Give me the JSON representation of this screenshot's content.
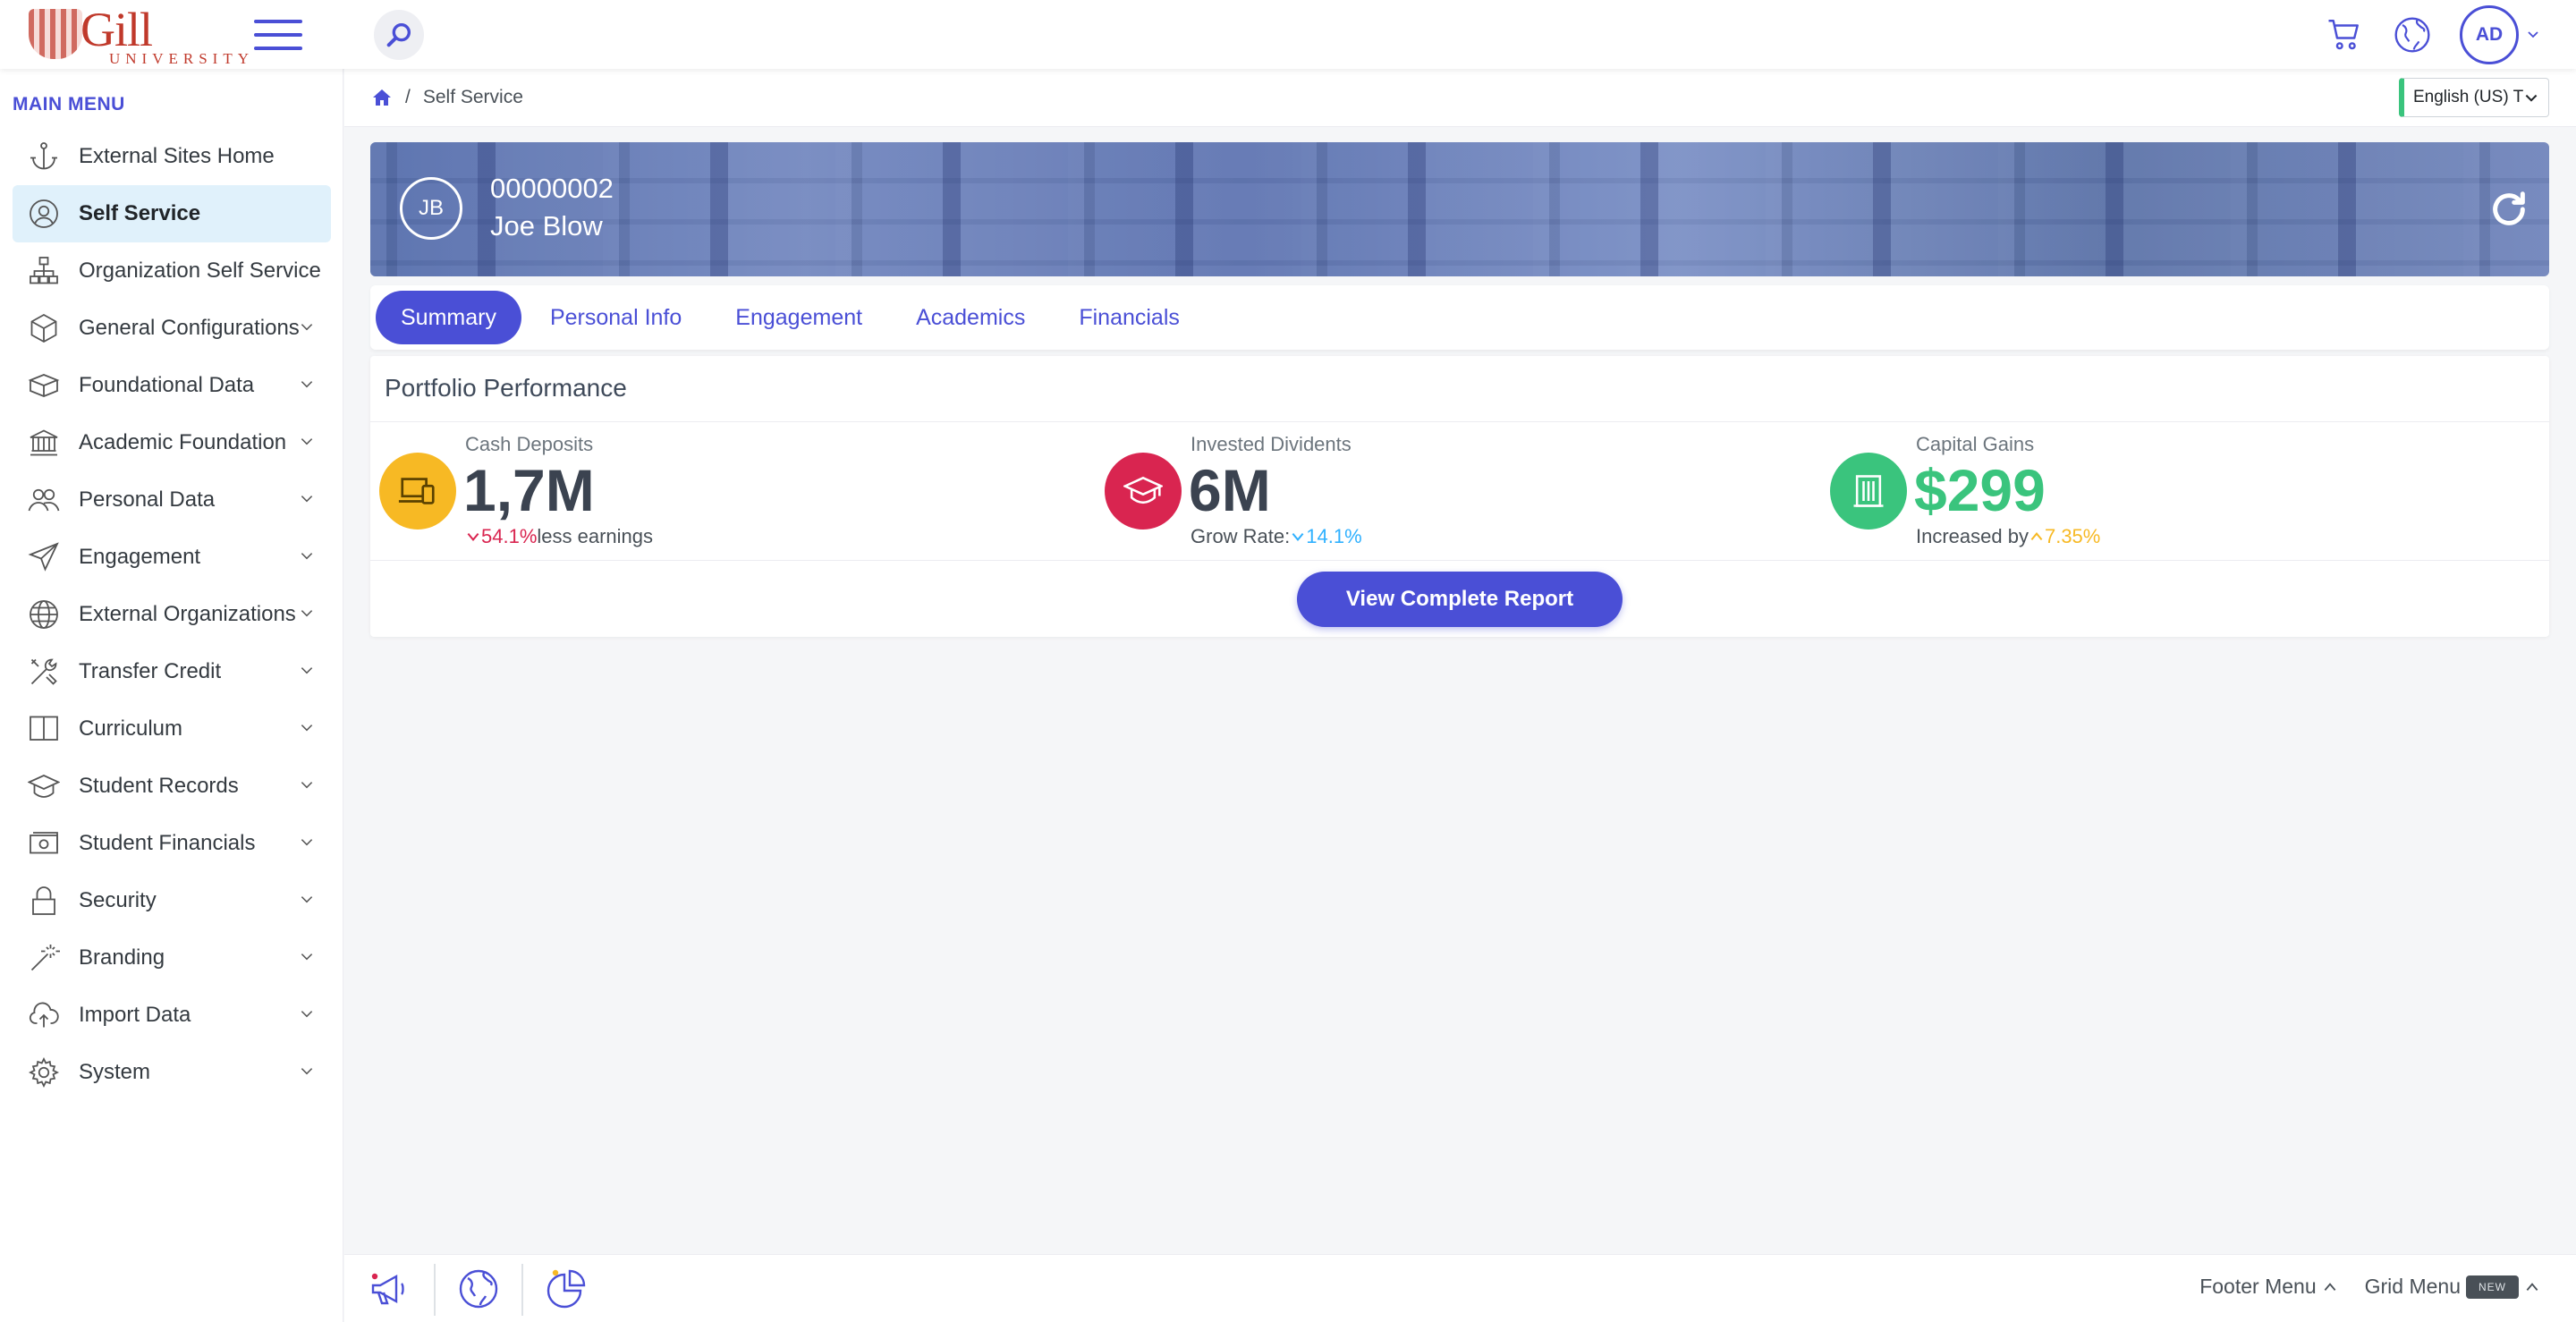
{
  "header": {
    "logo_text": "Gill",
    "logo_sub": "UNIVERSITY",
    "avatar_initials": "AD"
  },
  "sidebar": {
    "heading": "MAIN MENU",
    "items": [
      {
        "label": "External Sites Home",
        "icon": "anchor-icon",
        "expandable": false
      },
      {
        "label": "Self Service",
        "icon": "user-circle-icon",
        "expandable": false,
        "active": true
      },
      {
        "label": "Organization Self Service",
        "icon": "org-chart-icon",
        "expandable": false
      },
      {
        "label": "General Configurations",
        "icon": "box-icon",
        "expandable": true
      },
      {
        "label": "Foundational Data",
        "icon": "boxes-icon",
        "expandable": true
      },
      {
        "label": "Academic Foundation",
        "icon": "institution-icon",
        "expandable": true
      },
      {
        "label": "Personal Data",
        "icon": "users-icon",
        "expandable": true
      },
      {
        "label": "Engagement",
        "icon": "paper-plane-icon",
        "expandable": true
      },
      {
        "label": "External Organizations",
        "icon": "globe-icon",
        "expandable": true
      },
      {
        "label": "Transfer Credit",
        "icon": "tools-icon",
        "expandable": true
      },
      {
        "label": "Curriculum",
        "icon": "book-icon",
        "expandable": true
      },
      {
        "label": "Student Records",
        "icon": "graduation-icon",
        "expandable": true
      },
      {
        "label": "Student Financials",
        "icon": "money-icon",
        "expandable": true
      },
      {
        "label": "Security",
        "icon": "lock-icon",
        "expandable": true
      },
      {
        "label": "Branding",
        "icon": "magic-wand-icon",
        "expandable": true
      },
      {
        "label": "Import Data",
        "icon": "cloud-upload-icon",
        "expandable": true
      },
      {
        "label": "System",
        "icon": "cog-icon",
        "expandable": true
      }
    ]
  },
  "breadcrumb": {
    "separator": "/",
    "current": "Self Service"
  },
  "language": {
    "selected": "English (US) T"
  },
  "profile": {
    "initials": "JB",
    "id": "00000002",
    "name": "Joe Blow"
  },
  "tabs": [
    {
      "label": "Summary",
      "active": true
    },
    {
      "label": "Personal Info"
    },
    {
      "label": "Engagement"
    },
    {
      "label": "Academics"
    },
    {
      "label": "Financials"
    }
  ],
  "portfolio": {
    "title": "Portfolio Performance",
    "metrics": [
      {
        "label": "Cash Deposits",
        "value": "1,7M",
        "trend": "down",
        "pct": "54.1%",
        "suffix": "less earnings",
        "prefix": "",
        "icon_color": "#f7b924",
        "pct_color": "#d92550",
        "value_color": "#3b4350",
        "icon": "laptop-icon"
      },
      {
        "label": "Invested Dividents",
        "value": "6M",
        "trend": "down",
        "pct": "14.1%",
        "prefix": "Grow Rate:",
        "suffix": "",
        "icon_color": "#d92550",
        "pct_color": "#30b1ff",
        "value_color": "#3b4350",
        "icon": "graduation-cap-icon"
      },
      {
        "label": "Capital Gains",
        "value": "$299",
        "trend": "up",
        "pct": "7.35%",
        "prefix": "Increased by",
        "suffix": "",
        "icon_color": "#3ac47d",
        "pct_color": "#f7b924",
        "value_color": "#3ac47d",
        "icon": "building-icon"
      }
    ],
    "button": "View Complete Report"
  },
  "footer": {
    "footer_menu": "Footer Menu",
    "grid_menu": "Grid Menu",
    "new_badge": "NEW"
  },
  "colors": {
    "primary": "#4a4fd6",
    "success": "#3ac47d",
    "danger": "#d92550",
    "warning": "#f7b924",
    "info": "#30b1ff"
  }
}
